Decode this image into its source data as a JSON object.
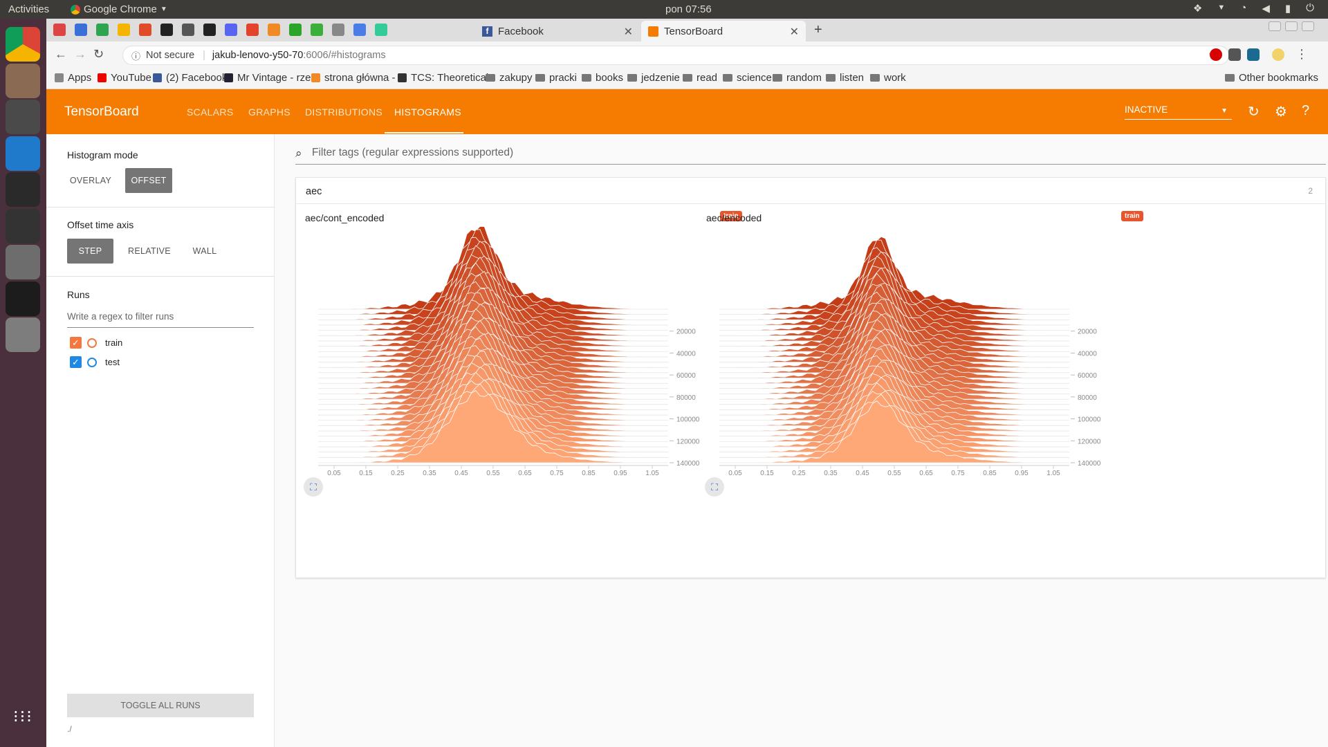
{
  "os": {
    "activities": "Activities",
    "app_name": "Google Chrome",
    "clock": "pon 07:56",
    "dock": [
      {
        "name": "chrome",
        "color": "#dd4b39"
      },
      {
        "name": "files",
        "color": "#8a6a53"
      },
      {
        "name": "sublime",
        "color": "#4a4a4a"
      },
      {
        "name": "vscode",
        "color": "#1f7acb"
      },
      {
        "name": "lock",
        "color": "#2a2a2a"
      },
      {
        "name": "terminal",
        "color": "#333333"
      },
      {
        "name": "camera",
        "color": "#6d6d6d"
      },
      {
        "name": "intellij",
        "color": "#1c1c1c"
      },
      {
        "name": "settings",
        "color": "#7d7d7d"
      }
    ]
  },
  "browser": {
    "tabs": [
      {
        "label": "Facebook",
        "active": false
      },
      {
        "label": "TensorBoard",
        "active": true
      }
    ],
    "url_security": "Not secure",
    "url_host": "jakub-lenovo-y50-70",
    "url_rest": ":6006/#histograms",
    "bookmarks": [
      "Apps",
      "YouTube",
      "(2) Facebook",
      "Mr Vintage - rze",
      "strona główna - ",
      "TCS: Theoretical",
      "zakupy",
      "pracki",
      "books",
      "jedzenie",
      "read",
      "science",
      "random",
      "listen",
      "work"
    ],
    "other_bookmarks": "Other bookmarks"
  },
  "tb": {
    "brand": "TensorBoard",
    "nav": [
      "SCALARS",
      "GRAPHS",
      "DISTRIBUTIONS",
      "HISTOGRAMS"
    ],
    "active_nav": "HISTOGRAMS",
    "status": "INACTIVE",
    "accent": "#f57c00"
  },
  "sidebar": {
    "hist_mode_label": "Histogram mode",
    "hist_modes": [
      "OVERLAY",
      "OFFSET"
    ],
    "hist_mode_selected": "OFFSET",
    "time_axis_label": "Offset time axis",
    "time_axes": [
      "STEP",
      "RELATIVE",
      "WALL"
    ],
    "time_axis_selected": "STEP",
    "runs_label": "Runs",
    "regex_placeholder": "Write a regex to filter runs",
    "runs": [
      {
        "name": "train",
        "checked": true,
        "color": "#f4773f"
      },
      {
        "name": "test",
        "checked": true,
        "color": "#1e88e5"
      }
    ],
    "toggle_all": "TOGGLE ALL RUNS",
    "logdir": "./"
  },
  "main": {
    "filter_placeholder": "Filter tags (regular expressions supported)",
    "group": {
      "name": "aec",
      "count": "2"
    },
    "cards": [
      {
        "title": "aec/cont_encoded",
        "run": "train"
      },
      {
        "title": "aec/encoded",
        "run": "train"
      }
    ]
  },
  "chart_data": [
    {
      "type": "area",
      "title": "aec/cont_encoded",
      "mode": "offset",
      "x_ticks": [
        "0.05",
        "0.15",
        "0.25",
        "0.35",
        "0.45",
        "0.55",
        "0.65",
        "0.75",
        "0.85",
        "0.95",
        "1.05"
      ],
      "step_ticks": [
        "20000",
        "40000",
        "60000",
        "80000",
        "100000",
        "120000",
        "140000"
      ],
      "xlim": [
        0.0,
        1.1
      ],
      "steps": [
        0,
        140000
      ],
      "peak_x": 0.5,
      "colors": {
        "oldest": "#c43c16",
        "newest": "#ffa877"
      }
    },
    {
      "type": "area",
      "title": "aec/encoded",
      "mode": "offset",
      "x_ticks": [
        "0.05",
        "0.15",
        "0.25",
        "0.35",
        "0.45",
        "0.55",
        "0.65",
        "0.75",
        "0.85",
        "0.95",
        "1.05"
      ],
      "step_ticks": [
        "20000",
        "40000",
        "60000",
        "80000",
        "100000",
        "120000",
        "140000"
      ],
      "xlim": [
        0.0,
        1.1
      ],
      "steps": [
        0,
        140000
      ],
      "peak_x": 0.5,
      "colors": {
        "oldest": "#c43c16",
        "newest": "#ffa877"
      }
    }
  ]
}
